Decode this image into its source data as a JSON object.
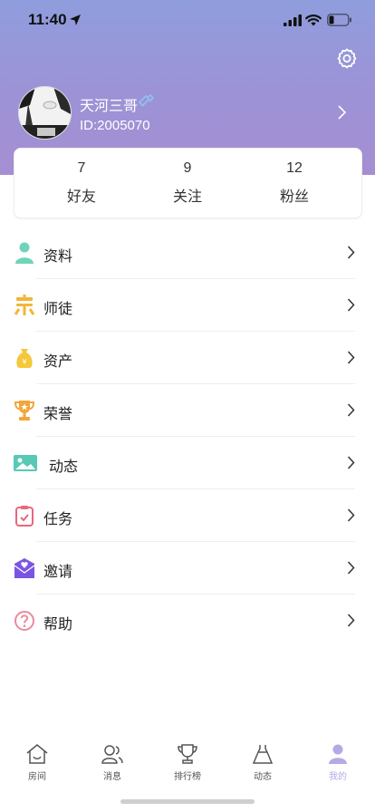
{
  "status_bar": {
    "time": "11:40"
  },
  "profile": {
    "username": "天河三哥",
    "user_id": "ID:2005070"
  },
  "stats": [
    {
      "count": "7",
      "label": "好友"
    },
    {
      "count": "9",
      "label": "关注"
    },
    {
      "count": "12",
      "label": "粉丝"
    }
  ],
  "menu": [
    {
      "label": "资料",
      "icon": "person-icon"
    },
    {
      "label": "师徒",
      "icon": "mentor-icon"
    },
    {
      "label": "资产",
      "icon": "money-bag-icon"
    },
    {
      "label": "荣誉",
      "icon": "trophy-icon"
    },
    {
      "label": "动态",
      "icon": "image-icon"
    },
    {
      "label": "任务",
      "icon": "task-icon"
    },
    {
      "label": "邀请",
      "icon": "invite-envelope-icon"
    },
    {
      "label": "帮助",
      "icon": "help-icon"
    }
  ],
  "tab_bar": {
    "tabs": [
      {
        "label": "房间",
        "icon": "house-icon"
      },
      {
        "label": "消息",
        "icon": "messages-icon"
      },
      {
        "label": "排行榜",
        "icon": "ranking-trophy-icon"
      },
      {
        "label": "动态",
        "icon": "dress-icon"
      },
      {
        "label": "我的",
        "icon": "me-icon"
      }
    ],
    "active_index": 4
  },
  "colors": {
    "header_gradient_top": "#8f9ddd",
    "header_gradient_bottom": "#a58fd2",
    "active_tab": "#b7a9e6",
    "verified_badge": "#8fc3f0"
  }
}
